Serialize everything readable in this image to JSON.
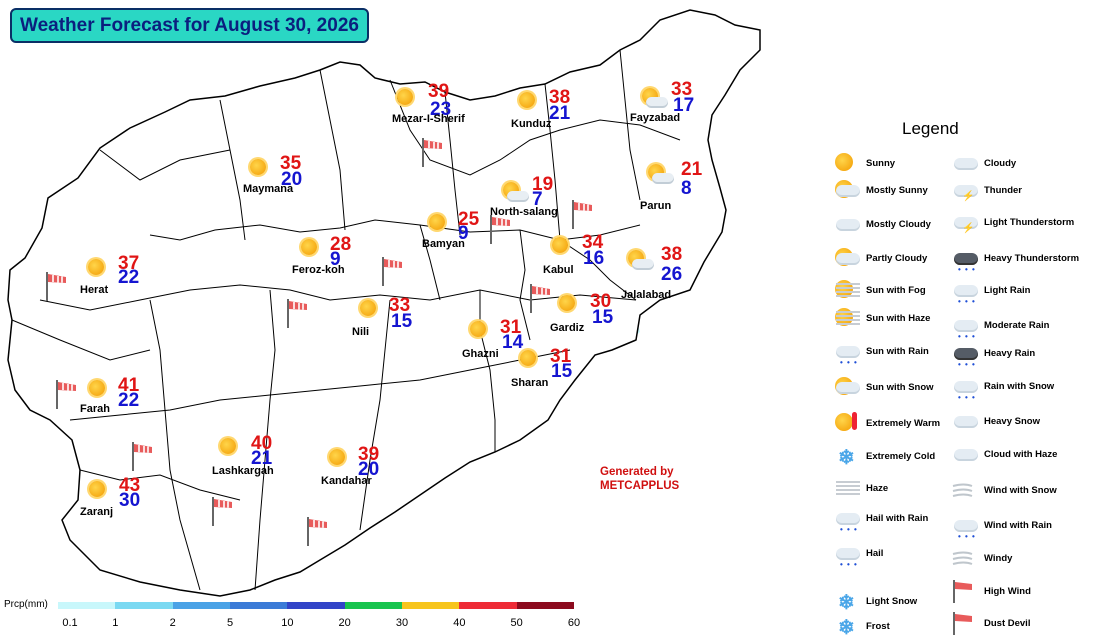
{
  "title": "Weather Forecast for August 30, 2026",
  "cities": [
    {
      "name": "Mezar-I-Sherif",
      "max": "39",
      "min": "23",
      "icon": "sunny"
    },
    {
      "name": "Kunduz",
      "max": "38",
      "min": "21",
      "icon": "sunny"
    },
    {
      "name": "Fayzabad",
      "max": "33",
      "min": "17",
      "icon": "mostly-sunny"
    },
    {
      "name": "Maymana",
      "max": "35",
      "min": "20",
      "icon": "sunny"
    },
    {
      "name": "North-salang",
      "max": "19",
      "min": "7",
      "icon": "mostly-sunny"
    },
    {
      "name": "Parun",
      "max": "21",
      "min": "8",
      "icon": "partly-cloudy"
    },
    {
      "name": "Feroz-koh",
      "max": "28",
      "min": "9",
      "icon": "sunny"
    },
    {
      "name": "Bamyan",
      "max": "25",
      "min": "9",
      "icon": "sunny"
    },
    {
      "name": "Kabul",
      "max": "34",
      "min": "16",
      "icon": "sunny"
    },
    {
      "name": "Jalalabad",
      "max": "38",
      "min": "26",
      "icon": "partly-cloudy"
    },
    {
      "name": "Herat",
      "max": "37",
      "min": "22",
      "icon": "sunny"
    },
    {
      "name": "Nili",
      "max": "33",
      "min": "15",
      "icon": "sunny"
    },
    {
      "name": "Gardiz",
      "max": "30",
      "min": "15",
      "icon": "sunny"
    },
    {
      "name": "Ghazni",
      "max": "31",
      "min": "14",
      "icon": "sunny"
    },
    {
      "name": "Sharan",
      "max": "31",
      "min": "15",
      "icon": "sunny"
    },
    {
      "name": "Farah",
      "max": "41",
      "min": "22",
      "icon": "sunny"
    },
    {
      "name": "Lashkargah",
      "max": "40",
      "min": "21",
      "icon": "sunny"
    },
    {
      "name": "Kandahar",
      "max": "39",
      "min": "20",
      "icon": "sunny"
    },
    {
      "name": "Zaranj",
      "max": "43",
      "min": "30",
      "icon": "sunny"
    }
  ],
  "legend": {
    "title": "Legend",
    "items": [
      {
        "label": "Sunny",
        "icon": "sunny-icon"
      },
      {
        "label": "Cloudy",
        "icon": "cloudy-icon"
      },
      {
        "label": "Mostly Sunny",
        "icon": "mostly-sunny-icon"
      },
      {
        "label": "Thunder",
        "icon": "thunder-icon"
      },
      {
        "label": "Mostly Cloudy",
        "icon": "mostly-cloudy-icon"
      },
      {
        "label": "Light Thunderstorm",
        "icon": "light-thunderstorm-icon"
      },
      {
        "label": "Partly Cloudy",
        "icon": "partly-cloudy-icon"
      },
      {
        "label": "Heavy Thunderstorm",
        "icon": "heavy-thunderstorm-icon"
      },
      {
        "label": "Sun with Fog",
        "icon": "sun-fog-icon"
      },
      {
        "label": "Light Rain",
        "icon": "light-rain-icon"
      },
      {
        "label": "Sun with Haze",
        "icon": "sun-haze-icon"
      },
      {
        "label": "Moderate Rain",
        "icon": "moderate-rain-icon"
      },
      {
        "label": "Sun with Rain",
        "icon": "sun-rain-icon"
      },
      {
        "label": "Heavy Rain",
        "icon": "heavy-rain-icon"
      },
      {
        "label": "Sun with Snow",
        "icon": "sun-snow-icon"
      },
      {
        "label": "Rain with Snow",
        "icon": "rain-snow-icon"
      },
      {
        "label": "Extremely Warm",
        "icon": "extremely-warm-icon"
      },
      {
        "label": "Heavy Snow",
        "icon": "heavy-snow-icon"
      },
      {
        "label": "Extremely Cold",
        "icon": "extremely-cold-icon"
      },
      {
        "label": "Cloud with Haze",
        "icon": "cloud-haze-icon"
      },
      {
        "label": "Haze",
        "icon": "haze-icon"
      },
      {
        "label": "Wind with Snow",
        "icon": "wind-snow-icon"
      },
      {
        "label": "Hail with Rain",
        "icon": "hail-rain-icon"
      },
      {
        "label": "Wind with Rain",
        "icon": "wind-rain-icon"
      },
      {
        "label": "Hail",
        "icon": "hail-icon"
      },
      {
        "label": "Windy",
        "icon": "windy-icon"
      },
      {
        "label": "Light Snow",
        "icon": "light-snow-icon"
      },
      {
        "label": "High Wind",
        "icon": "high-wind-icon"
      },
      {
        "label": "Frost",
        "icon": "frost-icon"
      },
      {
        "label": "Dust Devil",
        "icon": "dust-devil-icon"
      }
    ]
  },
  "credit": {
    "line1": "Generated by",
    "line2": "METCAPPLUS"
  },
  "precip_scale": {
    "label": "Prcp(mm)",
    "ticks": [
      "0.1",
      "1",
      "2",
      "5",
      "10",
      "20",
      "30",
      "40",
      "50",
      "60"
    ],
    "colors": [
      "#c8f7fb",
      "#7ad9f2",
      "#4aa2e6",
      "#3b7bd7",
      "#3244c8",
      "#18c44e",
      "#f7c51d",
      "#ee2b37",
      "#8c0a1e"
    ]
  },
  "colors": {
    "max_temp": "#e01515",
    "min_temp": "#1515d0",
    "title_bg": "#2ad7c4"
  }
}
